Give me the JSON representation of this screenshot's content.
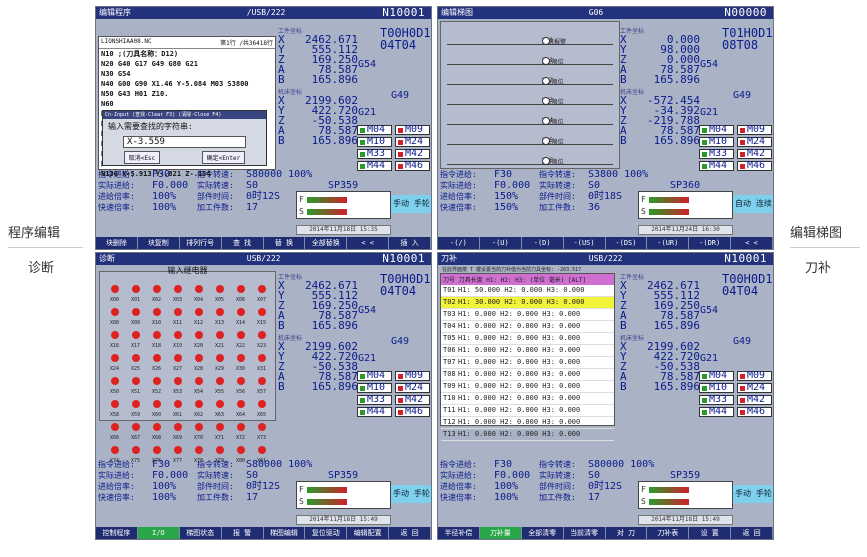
{
  "side_labels": {
    "left_top": "程序编辑",
    "left_bottom": "诊断",
    "right_top": "编辑梯图",
    "right_bottom": "刀补"
  },
  "panels": {
    "common": {
      "coords_label": "工件坐标",
      "coords_label2": "机床坐标",
      "machine": [
        [
          "X",
          "2462.671"
        ],
        [
          "Y",
          "555.112"
        ],
        [
          "Z",
          "169.250"
        ],
        [
          "A",
          "78.587"
        ],
        [
          "B",
          "165.896"
        ]
      ],
      "work": [
        [
          "X",
          "2199.602"
        ],
        [
          "Y",
          "422.720"
        ],
        [
          "Z",
          "-50.538"
        ],
        [
          "A",
          "78.587"
        ],
        [
          "B",
          "165.896"
        ]
      ],
      "g54": "G54",
      "g49": "G49",
      "g21": "G21",
      "mcodes": [
        "M04",
        "M09",
        "M10",
        "M24",
        "M33",
        "M42",
        "M44",
        "M46"
      ]
    },
    "prog": {
      "title": "编辑程序",
      "path": "/USB/222",
      "n": "N10001",
      "tcode": "T00H0D1\n04T04",
      "file": "LIONSHIAA08.NC",
      "line_info": "第1行 /共36418行",
      "lines": [
        "N10 ;(刀具名称：D12)",
        "N20 G40 G17 G49 G80 G21",
        "N30 G54",
        "N40 G00 G90 X1.46 Y-5.084 M03 S3800",
        "N50 G43 H01 Z10.",
        "N60",
        "N70",
        "N80",
        "N90",
        "N10",
        "N110 X-5.956 Y-.412 Z-.151",
        "N120 X-5.938 Y-.617 Z-.152",
        "N130 X-5.913 Y-.821 Z-.154"
      ],
      "foot_path": "/NC",
      "dialog": {
        "title": "Cn-Input (查找-Clear F3) (清除-Close F4)",
        "prompt": "输入需要查找的字符串:",
        "value": "X-3.559",
        "cancel": "取消<Esc",
        "ok": "确定<Enter"
      },
      "status": [
        [
          "指令进给:",
          "F30",
          "指令转速:",
          "S80000 100%"
        ],
        [
          "实际进给:",
          "F0.000",
          "实际转速:",
          "S0"
        ],
        [
          "进给倍率:",
          "100%",
          "部件时间:",
          "0时12S"
        ],
        [
          "快速倍率:",
          "100%",
          "加工件数:",
          "17"
        ]
      ],
      "sp": "SP359",
      "mode": "手动 手轮 X ×1",
      "date": "2014年11月18日 15:35",
      "softkeys": [
        "块删除",
        "块复制",
        "排列行号",
        "查 找",
        "替 换",
        "全部替换",
        "< <",
        "插 入"
      ]
    },
    "ladder": {
      "title": "编辑梯图",
      "path": "G06",
      "n": "N00000",
      "tcode": "T01H0D1\n08T08",
      "machine": [
        [
          "X",
          "0.000"
        ],
        [
          "Y",
          "98.000"
        ],
        [
          "Z",
          "0.000"
        ],
        [
          "A",
          "78.587"
        ],
        [
          "B",
          "165.896"
        ]
      ],
      "work": [
        [
          "X",
          "-572.454"
        ],
        [
          "Y",
          "-34.392"
        ],
        [
          "Z",
          "-219.788"
        ],
        [
          "A",
          "78.587"
        ],
        [
          "B",
          "165.896"
        ]
      ],
      "rungs": [
        {
          "name": "系统报警",
          "addr": "Y00"
        },
        {
          "name": "X正限位",
          "addr": "Y01"
        },
        {
          "name": "X负限位",
          "addr": "Y02"
        },
        {
          "name": "Y正限位",
          "addr": "Y03"
        },
        {
          "name": "Y负限位",
          "addr": "Y04"
        },
        {
          "name": "Z正限位",
          "addr": "Y05"
        },
        {
          "name": "Z负限位",
          "addr": "Y06"
        }
      ],
      "status": [
        [
          "指令进给:",
          "F30",
          "指令转速:",
          "S3800 100%"
        ],
        [
          "实际进给:",
          "F0.000",
          "实际转速:",
          "S0"
        ],
        [
          "进给倍率:",
          "150%",
          "部件时间:",
          "0时18S"
        ],
        [
          "快速倍率:",
          "150%",
          "加工件数:",
          "36"
        ]
      ],
      "sp": "SP360",
      "mode": "自动 连续 停止",
      "date": "2014年11月24日 16:30",
      "softkeys": [
        "-(/)",
        "-(U)",
        "-(D)",
        "-(US)",
        "-(DS)",
        "-(UR)",
        "-(DR)",
        "< <"
      ]
    },
    "diag": {
      "title": "诊断",
      "path": "USB/222",
      "n": "N10001",
      "heading": "输入继电器",
      "lamps": [
        "X00",
        "X01",
        "X02",
        "X03",
        "X04",
        "X05",
        "X06",
        "X07",
        "X08",
        "X09",
        "X10",
        "X11",
        "X12",
        "X13",
        "X14",
        "X15",
        "X16",
        "X17",
        "X18",
        "X19",
        "X20",
        "X21",
        "X22",
        "X23",
        "X24",
        "X25",
        "X26",
        "X27",
        "X28",
        "X29",
        "X30",
        "X31",
        "X50",
        "X51",
        "X52",
        "X53",
        "X54",
        "X55",
        "X56",
        "X57",
        "X58",
        "X59",
        "X60",
        "X61",
        "X62",
        "X63",
        "X64",
        "X65",
        "X66",
        "X67",
        "X68",
        "X69",
        "X70",
        "X71",
        "X72",
        "X73",
        "X74",
        "X75",
        "X76",
        "X77",
        "X78",
        "X79",
        "X80",
        "X81"
      ],
      "tcode": "T00H0D1\n04T04",
      "status": [
        [
          "指令进给:",
          "F30",
          "指令转速:",
          "S80000 100%"
        ],
        [
          "实际进给:",
          "F0.000",
          "实际转速:",
          "S0"
        ],
        [
          "进给倍率:",
          "100%",
          "部件时间:",
          "0时12S"
        ],
        [
          "快速倍率:",
          "100%",
          "加工件数:",
          "17"
        ]
      ],
      "sp": "SP359",
      "mode": "手动 手轮 X ×1",
      "date": "2014年11月18日 15:49",
      "softkeys": [
        "控制程序",
        "I/O",
        "梯图状态",
        "报 警",
        "梯图编辑",
        "复位驱动",
        "编辑配置",
        "返 回"
      ]
    },
    "tool": {
      "title": "刀补",
      "path": "USB/222",
      "n": "N10001",
      "info": "在此界面按 T 键设置当前刀补值为当前刀具坐标: -263.517",
      "header": "刀号 刀具长度 H1: H2: H3: (单位 毫米) [ALT]",
      "rows": [
        [
          "T01",
          "H1: 50.000 H2: 0.000 H3: 0.000"
        ],
        [
          "T02",
          "H1: 30.000 H2: 0.000 H3: 0.000"
        ],
        [
          "T03",
          "H1: 0.000 H2: 0.000 H3: 0.000"
        ],
        [
          "T04",
          "H1: 0.000 H2: 0.000 H3: 0.000"
        ],
        [
          "T05",
          "H1: 0.000 H2: 0.000 H3: 0.000"
        ],
        [
          "T06",
          "H1: 0.000 H2: 0.000 H3: 0.000"
        ],
        [
          "T07",
          "H1: 0.000 H2: 0.000 H3: 0.000"
        ],
        [
          "T08",
          "H1: 0.000 H2: 0.000 H3: 0.000"
        ],
        [
          "T09",
          "H1: 0.000 H2: 0.000 H3: 0.000"
        ],
        [
          "T10",
          "H1: 0.000 H2: 0.000 H3: 0.000"
        ],
        [
          "T11",
          "H1: 0.000 H2: 0.000 H3: 0.000"
        ],
        [
          "T12",
          "H1: 0.000 H2: 0.000 H3: 0.000"
        ],
        [
          "T13",
          "H1: 0.000 H2: 0.000 H3: 0.000"
        ]
      ],
      "selected": 1,
      "tcode": "T00H0D1\n04T04",
      "status": [
        [
          "指令进给:",
          "F30",
          "指令转速:",
          "S80000 100%"
        ],
        [
          "实际进给:",
          "F0.000",
          "实际转速:",
          "S0"
        ],
        [
          "进给倍率:",
          "100%",
          "部件时间:",
          "0时12S"
        ],
        [
          "快速倍率:",
          "100%",
          "加工件数:",
          "17"
        ]
      ],
      "sp": "SP359",
      "mode": "手动 手轮 X ×1",
      "date": "2014年11月18日 15:49",
      "softkeys": [
        "半径补偿",
        "刀补量",
        "全部清零",
        "当前清零",
        "对 刀",
        "刀补表",
        "设 置",
        "返 回"
      ]
    }
  }
}
